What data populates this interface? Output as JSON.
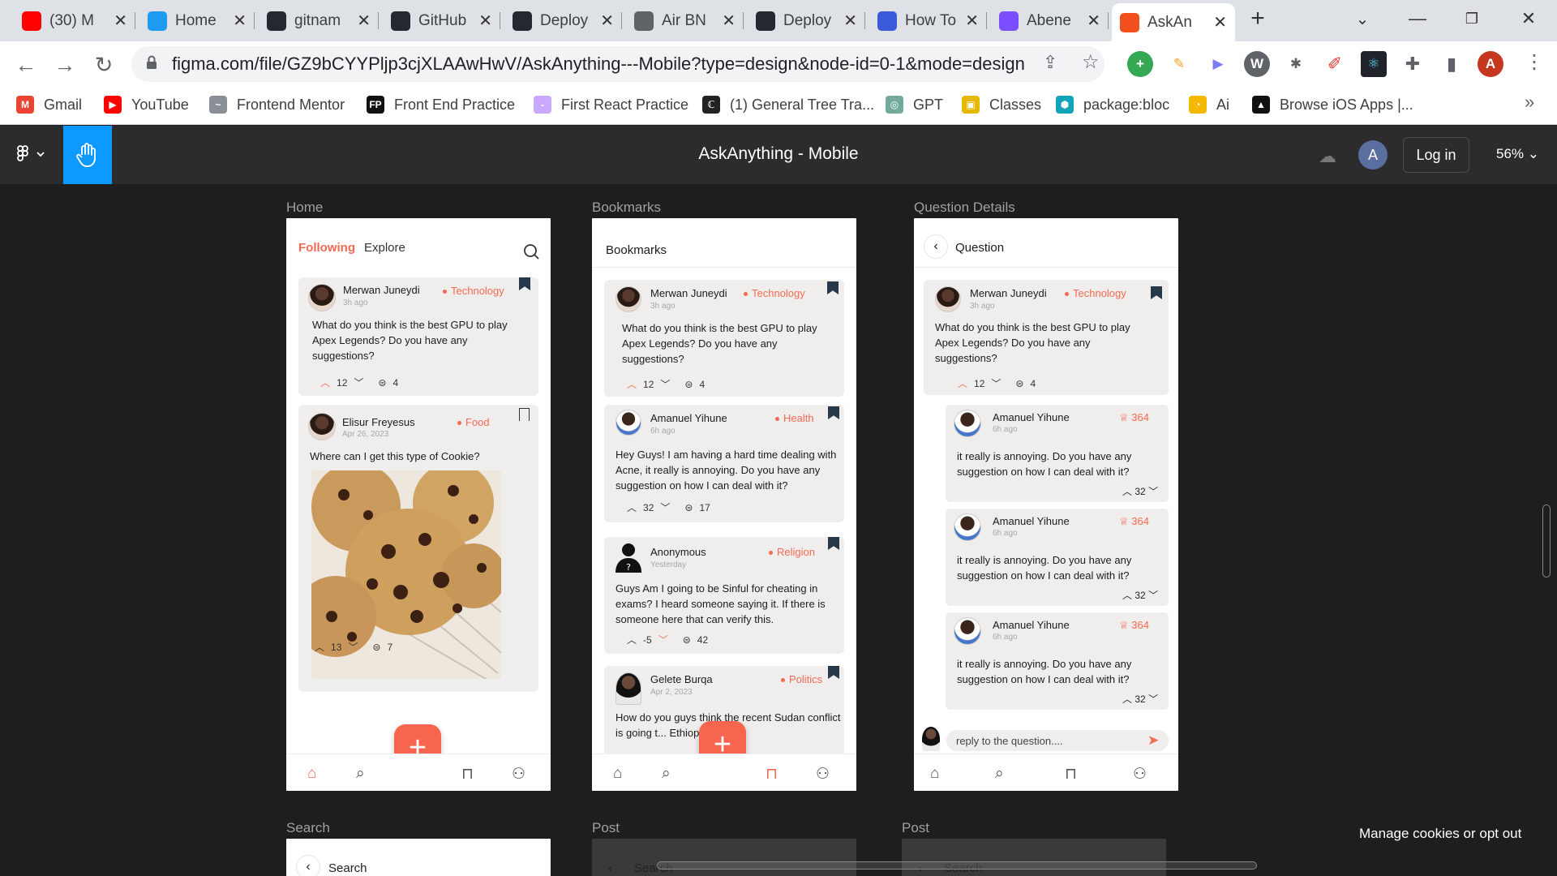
{
  "browser": {
    "tabs": [
      {
        "title": "(30) M",
        "icon": "youtube-icon",
        "color": "#ff0000"
      },
      {
        "title": "Home",
        "icon": "twitter-icon",
        "color": "#1d9bf0"
      },
      {
        "title": "gitnam",
        "icon": "github-icon",
        "color": "#24292f"
      },
      {
        "title": "GitHub",
        "icon": "github-icon",
        "color": "#24292f"
      },
      {
        "title": "Deploy",
        "icon": "github-icon",
        "color": "#24292f"
      },
      {
        "title": "Air BN",
        "icon": "globe-icon",
        "color": "#5f6368"
      },
      {
        "title": "Deploy",
        "icon": "github-icon",
        "color": "#24292f"
      },
      {
        "title": "How To",
        "icon": "flag-icon",
        "color": "#3b5bdb"
      },
      {
        "title": "Abene",
        "icon": "bot-icon",
        "color": "#7b4fff"
      },
      {
        "title": "AskAn",
        "icon": "figma-icon",
        "color": "#f24e1e",
        "active": true
      }
    ],
    "new_tab": "+",
    "url": "figma.com/file/GZ9bCYYPljp3cjXLAAwHwV/AskAnything---Mobile?type=design&node-id=0-1&mode=design",
    "profile_initial": "A",
    "bookmarks": [
      {
        "label": "Gmail",
        "color": "#ea4335",
        "glyph": "M"
      },
      {
        "label": "YouTube",
        "color": "#ff0000",
        "glyph": "▶"
      },
      {
        "label": "Frontend Mentor",
        "color": "#8a8f98",
        "glyph": "~"
      },
      {
        "label": "Front End Practice",
        "color": "#111",
        "glyph": "FP"
      },
      {
        "label": "First React Practice",
        "color": "#c9a8ff",
        "glyph": "-"
      },
      {
        "label": "(1) General Tree Tra...",
        "color": "#222",
        "glyph": "ℂ"
      },
      {
        "label": "GPT",
        "color": "#74aa9c",
        "glyph": "◎"
      },
      {
        "label": "Classes",
        "color": "#e6b800",
        "glyph": "▣"
      },
      {
        "label": "package:bloc",
        "color": "#12a4b8",
        "glyph": "⬢"
      },
      {
        "label": "Ai",
        "color": "#f5b800",
        "glyph": "◔"
      },
      {
        "label": "Browse iOS Apps |...",
        "color": "#111",
        "glyph": "▲"
      }
    ],
    "more_bookmarks": "»"
  },
  "figma": {
    "title": "AskAnything - Mobile",
    "login_label": "Log in",
    "avatar_initial": "A",
    "zoom": "56%",
    "cookies": "Manage cookies or opt out"
  },
  "frames": {
    "home": {
      "label": "Home",
      "tabs": [
        "Following",
        "Explore"
      ],
      "posts": [
        {
          "user": "Merwan Juneydi",
          "time": "3h ago",
          "category": "Technology",
          "text": "What do you think is the best GPU to play Apex Legends?  Do you have any suggestions?",
          "votes": "12",
          "comments": "4"
        },
        {
          "user": "Elisur Freyesus",
          "time": "Apr 26, 2023",
          "category": "Food",
          "text": "Where can I get this type of Cookie?",
          "votes": "13",
          "comments": "7"
        }
      ],
      "fab": "+"
    },
    "bookmarks": {
      "label": "Bookmarks",
      "header": "Bookmarks",
      "posts": [
        {
          "user": "Merwan Juneydi",
          "time": "3h ago",
          "category": "Technology",
          "text": "What do you think is the best GPU to play Apex Legends?  Do you have any suggestions?",
          "votes": "12",
          "comments": "4"
        },
        {
          "user": "Amanuel Yihune",
          "time": "6h ago",
          "category": "Health",
          "text": "Hey Guys! I am having a hard time dealing with Acne, it really is annoying. Do you have any suggestion on how I can deal with it?",
          "votes": "32",
          "comments": "17"
        },
        {
          "user": "Anonymous",
          "time": "Yesterday",
          "category": "Religion",
          "text": "Guys Am I going to be Sinful for cheating in exams? I heard someone saying it. If there is someone here that can verify this.",
          "votes": "-5",
          "comments": "42"
        },
        {
          "user": "Gelete Burqa",
          "time": "Apr 2, 2023",
          "category": "Politics",
          "text": "How do you guys think the recent Sudan conflict is going t... Ethiopia?"
        }
      ],
      "fab": "+"
    },
    "question": {
      "label": "Question Details",
      "header": "Question",
      "post": {
        "user": "Merwan Juneydi",
        "time": "3h ago",
        "category": "Technology",
        "text": "What do you think is the best GPU to play Apex Legends?  Do you have any suggestions?",
        "votes": "12",
        "comments": "4"
      },
      "answers": [
        {
          "user": "Amanuel Yihune",
          "time": "6h ago",
          "score": "364",
          "text": "it really is annoying. Do you have any suggestion on how I can deal with it?",
          "votes": "32"
        },
        {
          "user": "Amanuel Yihune",
          "time": "6h ago",
          "score": "364",
          "text": "it really is annoying. Do you have any suggestion on how I can deal with it?",
          "votes": "32"
        },
        {
          "user": "Amanuel Yihune",
          "time": "6h ago",
          "score": "364",
          "text": "it really is annoying. Do you have any suggestion on how I can deal with it?",
          "votes": "32"
        }
      ],
      "reply_placeholder": "reply to the question...."
    },
    "search": {
      "label": "Search",
      "header": "Search"
    },
    "post1": {
      "label": "Post",
      "header": "Search"
    },
    "post2": {
      "label": "Post",
      "header": "Search"
    }
  }
}
